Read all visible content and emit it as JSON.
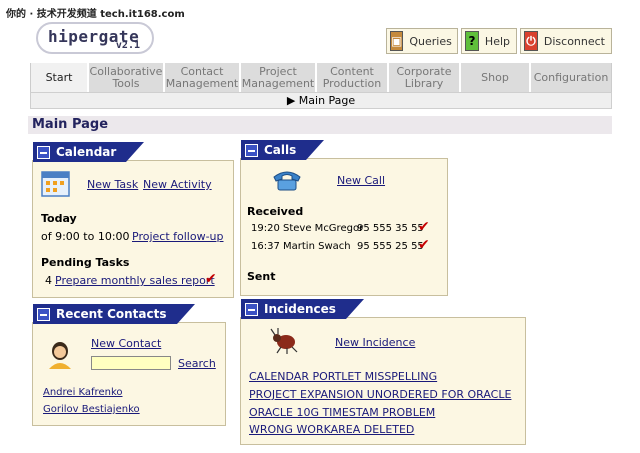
{
  "watermark": "你的 · 技术开发频道 tech.it168.com",
  "logo": {
    "name": "hipergate",
    "version": "v2.1"
  },
  "top_buttons": [
    {
      "label": "Queries",
      "icon": "queries-icon",
      "glyph": "▣"
    },
    {
      "label": "Help",
      "icon": "help-icon",
      "glyph": "?"
    },
    {
      "label": "Disconnect",
      "icon": "disconnect-icon",
      "glyph": "⏻"
    }
  ],
  "tabs": {
    "start": "Start",
    "collaborative": [
      "Collaborative",
      "Tools"
    ],
    "contact": [
      "Contact",
      "Management"
    ],
    "project": [
      "Project",
      "Management"
    ],
    "content": [
      "Content",
      "Production"
    ],
    "corporate": [
      "Corporate",
      "Library"
    ],
    "shop": "Shop",
    "configuration": "Configuration"
  },
  "breadcrumb": "▶ Main Page",
  "page_title": "Main Page",
  "calendar": {
    "title": "Calendar",
    "new_task": "New Task",
    "new_activity": "New Activity",
    "today_label": "Today",
    "meeting_time": "of 9:00 to 10:00",
    "meeting_link": "Project follow-up",
    "pending_label": "Pending Tasks",
    "pending_count": "4",
    "pending_link": "Prepare monthly sales report"
  },
  "calls": {
    "title": "Calls",
    "new_call": "New Call",
    "received_label": "Received",
    "received": [
      {
        "time": "19:20",
        "name": "Steve McGregor",
        "phone": "95 555 35 55"
      },
      {
        "time": "16:37",
        "name": "Martin Swach",
        "phone": "95 555 25 55"
      }
    ],
    "sent_label": "Sent"
  },
  "contacts": {
    "title": "Recent Contacts",
    "new_contact": "New Contact",
    "search_value": "",
    "search_label": "Search",
    "items": [
      "Andrei Kafrenko",
      "Gorilov Bestiajenko"
    ]
  },
  "incidences": {
    "title": "Incidences",
    "new_incidence": "New Incidence",
    "items": [
      "CALENDAR PORTLET MISSPELLING",
      "PROJECT EXPANSION UNORDERED FOR ORACLE",
      "ORACLE 10G TIMESTAM PROBLEM",
      "WRONG WORKAREA DELETED"
    ]
  },
  "colors": {
    "portlet_header": "#1f2d8c",
    "portlet_bg": "#fcf7e3",
    "title_text": "#23235e",
    "check": "#c40000"
  }
}
